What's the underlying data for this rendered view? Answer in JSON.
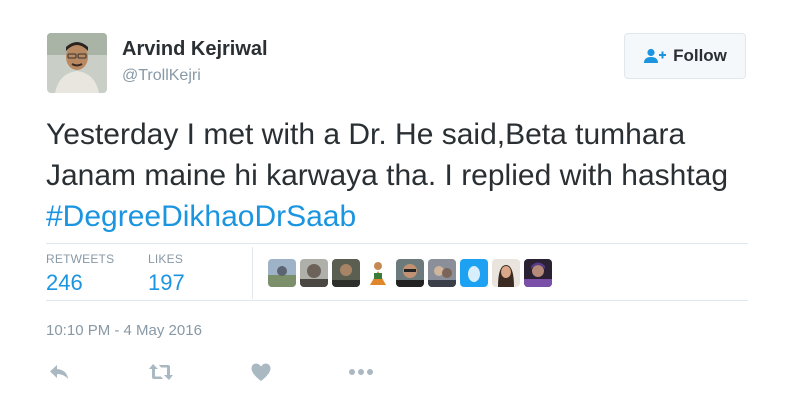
{
  "author": {
    "name": "Arvind Kejriwal",
    "handle": "@TrollKejri"
  },
  "follow_button": {
    "label": "Follow",
    "icon": "add-user-icon"
  },
  "tweet": {
    "text": "Yesterday I met with a Dr. He said,Beta tumhara Janam maine hi karwaya tha. I replied with hashtag ",
    "hashtag": "#DegreeDikhaoDrSaab"
  },
  "stats": {
    "retweets_label": "RETWEETS",
    "retweets_count": "246",
    "likes_label": "LIKES",
    "likes_count": "197"
  },
  "likers": [
    "avatar-1",
    "avatar-2",
    "avatar-3",
    "avatar-4",
    "avatar-5",
    "avatar-6",
    "avatar-7",
    "avatar-8",
    "avatar-9"
  ],
  "timestamp": "10:10 PM - 4 May 2016",
  "actions": [
    "reply-icon",
    "retweet-icon",
    "like-icon",
    "more-icon"
  ],
  "colors": {
    "link": "#1b95e0",
    "text": "#292f33",
    "muted": "#8899a6",
    "border": "#e1e8ed",
    "icon": "#aab8c2"
  }
}
